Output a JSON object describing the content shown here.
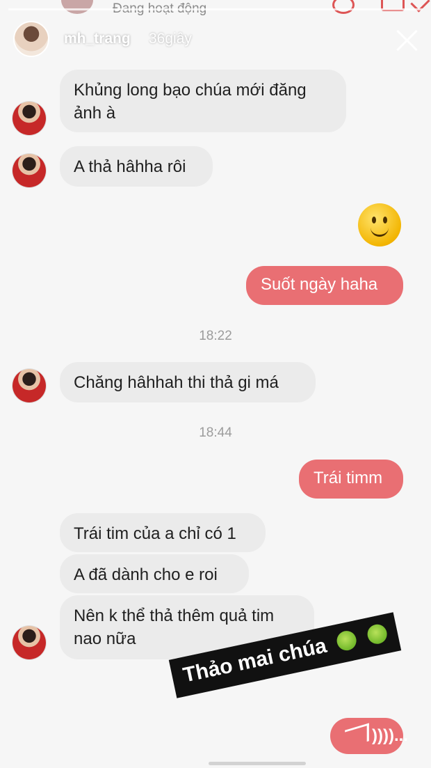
{
  "status_bar": {
    "active_status": "Đang hoạt động"
  },
  "story": {
    "username": "mh_trang",
    "time_ago": "36giây"
  },
  "messages": [
    {
      "type": "in",
      "text": "Khủng long bạo chúa mới đăng\nảnh à"
    },
    {
      "type": "in",
      "text": "A thả hâhha rôi"
    },
    {
      "type": "emoji",
      "name": "slightly-smiling-face-icon"
    },
    {
      "type": "out",
      "text": "Suốt ngày haha"
    },
    {
      "type": "time",
      "text": "18:22"
    },
    {
      "type": "in",
      "text": "Chăng hâhhah thi thả gi má"
    },
    {
      "type": "time",
      "text": "18:44"
    },
    {
      "type": "out",
      "text": "Trái timm"
    },
    {
      "type": "in",
      "text": "Trái tim của a chỉ có 1"
    },
    {
      "type": "in",
      "text": "A đã dành cho e roi"
    },
    {
      "type": "in",
      "text": "Nên k thể thả thêm quả tim\nnao nữa"
    }
  ],
  "sticker": {
    "text": "Thảo mai chúa"
  },
  "send": {
    "label": "))))..."
  },
  "colors": {
    "outgoing_bubble": "#e96f73",
    "incoming_bubble": "#ebebeb",
    "background": "#f6f6f6"
  }
}
